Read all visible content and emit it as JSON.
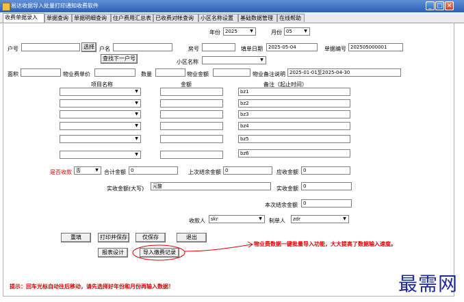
{
  "window": {
    "title": "易达收据导入批量打印通知收费软件",
    "controls": {
      "minimize": "_",
      "maximize": "□",
      "close": "✕"
    }
  },
  "tabs": [
    {
      "label": "收费单据录入",
      "active": true
    },
    {
      "label": "单据查询"
    },
    {
      "label": "单据明细查询"
    },
    {
      "label": "住户费用汇总表"
    },
    {
      "label": "已收费对帐查询"
    },
    {
      "label": "小区名称设置"
    },
    {
      "label": "基础数据管理"
    },
    {
      "label": "在线帮助"
    }
  ],
  "form": {
    "year_label": "年份",
    "year_value": "2025",
    "month_label": "月份",
    "month_value": "05",
    "household_no_label": "户号",
    "household_no_value": "",
    "select_button": "选择",
    "household_name_label": "户名",
    "household_name_value": "",
    "room_no_label": "房号",
    "room_no_value": "",
    "fill_date_label": "填单日期",
    "fill_date_value": "2025-05-04",
    "receipt_no_label": "单据编号",
    "receipt_no_value": "202505000001",
    "find_next_button": "查找下一户号",
    "community_label": "小区名称",
    "community_value": "",
    "area_label": "面积",
    "area_value": "",
    "unit_price_label": "物业费单价",
    "unit_price_value": "",
    "quantity_label": "数量",
    "quantity_value": "",
    "fee_amount_label": "物业金额",
    "fee_amount_value": "",
    "fee_note_label": "物业备注说明",
    "fee_note_value": "2025-01-01至2025-04-30"
  },
  "items_table": {
    "headers": {
      "item": "项目名称",
      "amount": "金额",
      "note": "备注（起止时间）"
    },
    "rows": [
      {
        "item": "",
        "amount": "",
        "note": "bz1"
      },
      {
        "item": "",
        "amount": "",
        "note": "bz2"
      },
      {
        "item": "",
        "amount": "",
        "note": "bz3"
      },
      {
        "item": "",
        "amount": "",
        "note": "bz4"
      },
      {
        "item": "",
        "amount": "",
        "note": "bz5"
      },
      {
        "item": "",
        "amount": "",
        "note": "bz6"
      }
    ]
  },
  "totals": {
    "is_paid_label": "是否收款",
    "is_paid_value": "否",
    "total_label": "合计金额",
    "total_value": "0",
    "last_balance_label": "上次结余金额",
    "last_balance_value": "0",
    "receivable_label": "应收金额",
    "receivable_value": "0",
    "actual_upper_label": "实收金额(大写)",
    "actual_upper_value": "元整",
    "actual_label": "实收金额",
    "actual_value": "0",
    "current_balance_label": "本次结余金额",
    "current_balance_value": "0",
    "payee_label": "收款人",
    "payee_value": "skr",
    "maker_label": "制单人",
    "maker_value": "zdr"
  },
  "buttons": {
    "reset": "重填",
    "print_save": "打印并保存",
    "save_only": "仅保存",
    "exit": "退出",
    "report_design": "报表设计",
    "import_records": "导入缴费记录"
  },
  "annotation": "物业费数据一键批量导入功能，大大提高了数据输入速度。",
  "hint": "提示：回车光标自动往后移动，请先选择好年份和月份再输入数据！",
  "brand": "最需网",
  "colors": {
    "title_bar": "#2d5fb7",
    "red_text": "#e00000",
    "brand": "#1d2a9c"
  }
}
